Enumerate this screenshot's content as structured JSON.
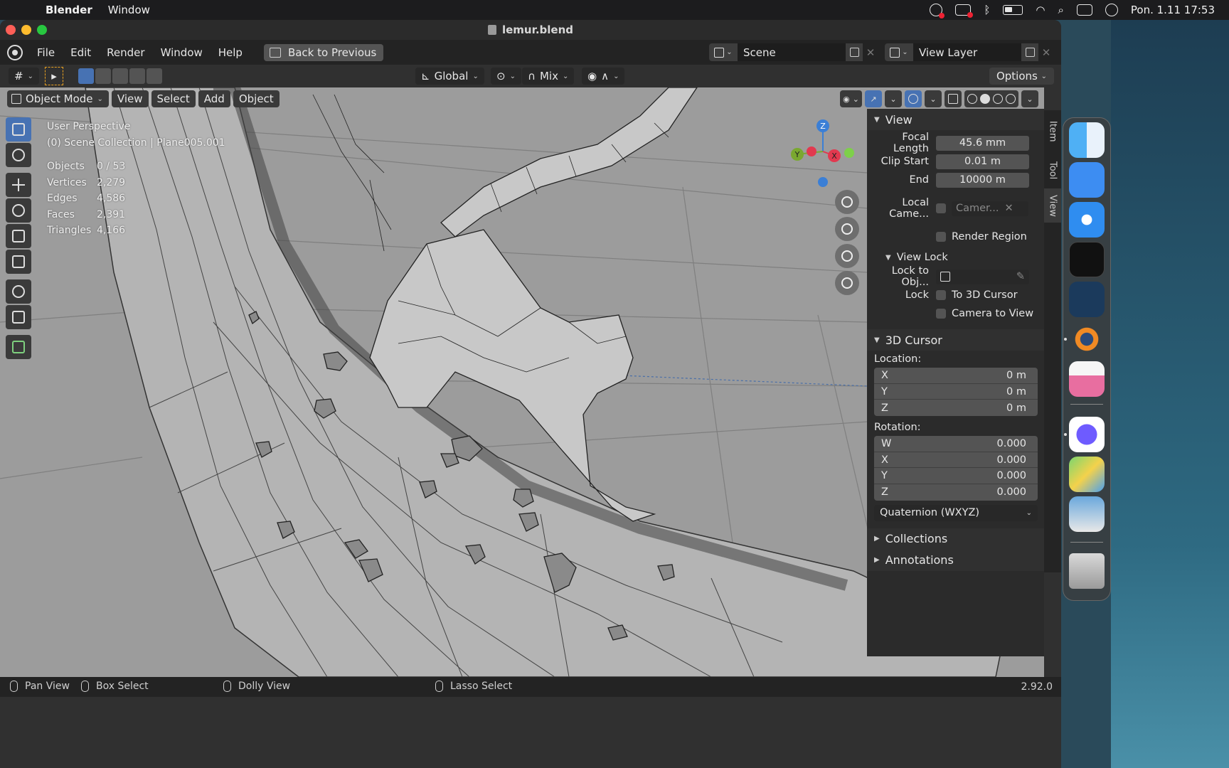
{
  "menubar": {
    "app_name": "Blender",
    "items": [
      "Window"
    ],
    "clock": "Pon. 1.11  17:53"
  },
  "window": {
    "title": "lemur.blend"
  },
  "topbar": {
    "menus": [
      "File",
      "Edit",
      "Render",
      "Window",
      "Help"
    ],
    "back_label": "Back to Previous",
    "scene": "Scene",
    "view_layer": "View Layer"
  },
  "toolrow": {
    "orientation": "Global",
    "snap_mode": "Mix",
    "options": "Options"
  },
  "viewport": {
    "mode": "Object Mode",
    "menus": [
      "View",
      "Select",
      "Add",
      "Object"
    ],
    "perspective": "User Perspective",
    "collection": "(0) Scene Collection | Plane005.001",
    "stats": [
      {
        "k": "Objects",
        "v": "0 / 53"
      },
      {
        "k": "Vertices",
        "v": "2,279"
      },
      {
        "k": "Edges",
        "v": "4,586"
      },
      {
        "k": "Faces",
        "v": "2,391"
      },
      {
        "k": "Triangles",
        "v": "4,166"
      }
    ],
    "gizmo": {
      "x": "X",
      "y": "Y",
      "z": "Z"
    }
  },
  "npanel": {
    "tabs": [
      "Item",
      "Tool",
      "View"
    ],
    "view": {
      "title": "View",
      "focal_label": "Focal Length",
      "focal": "45.6 mm",
      "clip_start_label": "Clip Start",
      "clip_start": "0.01 m",
      "end_label": "End",
      "end": "10000 m",
      "local_camera_label": "Local Came...",
      "local_camera": "Camer...",
      "render_region": "Render Region"
    },
    "view_lock": {
      "title": "View Lock",
      "lock_obj_label": "Lock to Obj...",
      "lock_label": "Lock",
      "to_cursor": "To 3D Cursor",
      "camera_to_view": "Camera to View"
    },
    "cursor": {
      "title": "3D Cursor",
      "location_label": "Location:",
      "location": [
        {
          "k": "X",
          "v": "0 m"
        },
        {
          "k": "Y",
          "v": "0 m"
        },
        {
          "k": "Z",
          "v": "0 m"
        }
      ],
      "rotation_label": "Rotation:",
      "rotation": [
        {
          "k": "W",
          "v": "0.000"
        },
        {
          "k": "X",
          "v": "0.000"
        },
        {
          "k": "Y",
          "v": "0.000"
        },
        {
          "k": "Z",
          "v": "0.000"
        }
      ],
      "rotation_mode": "Quaternion (WXYZ)"
    },
    "collections": "Collections",
    "annotations": "Annotations"
  },
  "statusbar": {
    "pan": "Pan View",
    "box": "Box Select",
    "dolly": "Dolly View",
    "lasso": "Lasso Select",
    "version": "2.92.0"
  },
  "dock": {
    "apps": [
      "finder-icon",
      "mail-icon",
      "safari-icon",
      "activity-monitor-icon",
      "steam-icon",
      "blender-icon",
      "cleanmymac-icon",
      "messenger-icon",
      "maps-icon",
      "preview-icon",
      "trash-icon"
    ]
  }
}
